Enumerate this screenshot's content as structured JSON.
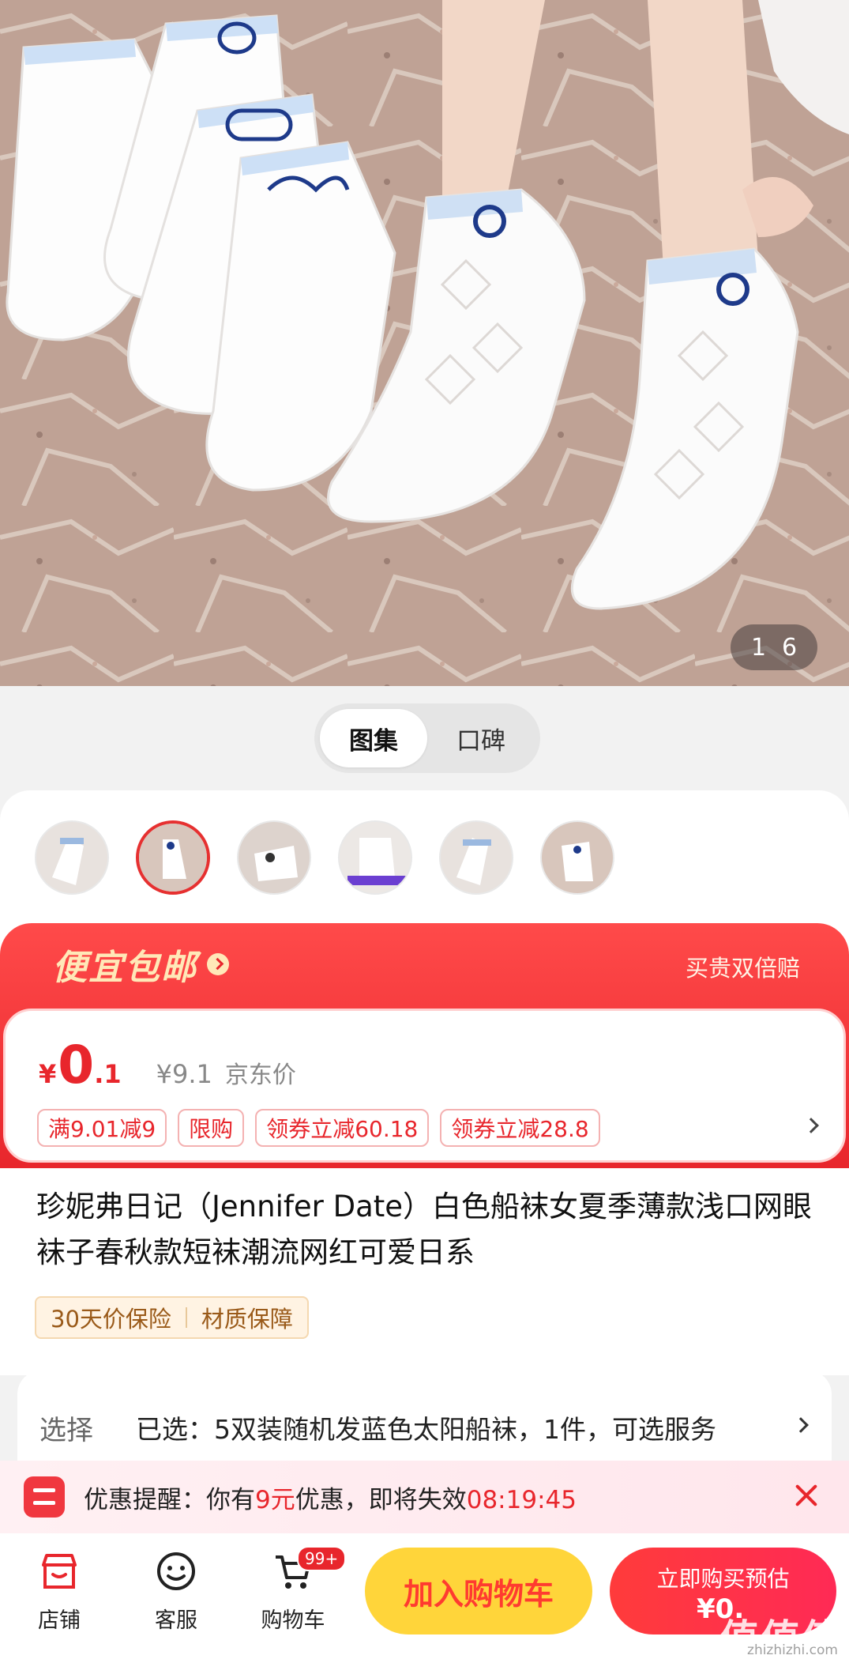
{
  "gallery": {
    "current": "1",
    "total": "6"
  },
  "segment": {
    "tabs": [
      "图集",
      "口碑"
    ],
    "active": "图集"
  },
  "promo": {
    "title": "便宜包邮",
    "right_text": "买贵双倍赔",
    "currency": "¥",
    "price_int": "0",
    "price_dec": ".1",
    "original_price": "¥9.1",
    "original_label": "京东价",
    "tags": [
      "满9.01减9",
      "限购",
      "领券立减60.18",
      "领券立减28.8"
    ]
  },
  "product": {
    "title": "珍妮弗日记（Jennifer Date）白色船袜女夏季薄款浅口网眼袜子春秋款短袜潮流网红可爱日系",
    "badges": [
      "30天价保险",
      "材质保障"
    ]
  },
  "selection": {
    "label": "选择",
    "text": "已选：5双装随机发蓝色太阳船袜，1件，可选服务"
  },
  "reminder": {
    "prefix": "优惠提醒：你有",
    "amount": "9元",
    "mid": "优惠，即将失效",
    "countdown": "08:19:45"
  },
  "bottom_bar": {
    "store": "店铺",
    "service": "客服",
    "cart": "购物车",
    "cart_badge": "99+",
    "add_to_cart": "加入购物车",
    "buy_now": "立即购买预估",
    "buy_price": "¥0."
  },
  "watermark": {
    "text": "值值值",
    "url": "zhizhizhi.com"
  },
  "colors": {
    "accent_red": "#e8262c",
    "cart_yellow": "#ffd53a",
    "promo_gold": "#ffe8b8"
  }
}
